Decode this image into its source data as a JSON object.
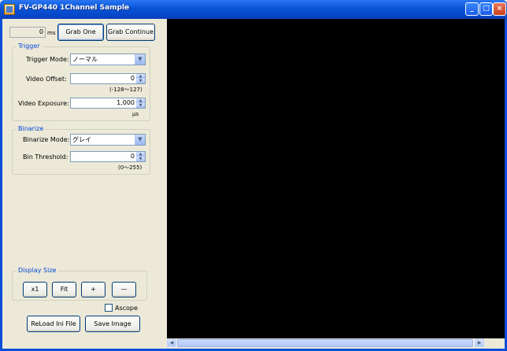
{
  "window": {
    "title": "FV-GP440 1Channel Sample",
    "minimize": "_",
    "maximize": "□",
    "close": "×"
  },
  "toolbar": {
    "ms_value": "0",
    "ms_unit": "ms",
    "grab_one": "Grab One",
    "grab_continue": "Grab Continue"
  },
  "trigger": {
    "legend": "Trigger",
    "mode_label": "Trigger Mode:",
    "mode_value": "ノーマル",
    "offset_label": "Video Offset:",
    "offset_value": "0",
    "offset_range": "(-128～127)",
    "exposure_label": "Video Exposure:",
    "exposure_value": "1,000",
    "exposure_unit": "μs"
  },
  "binarize": {
    "legend": "Binarize",
    "mode_label": "Binarize Mode:",
    "mode_value": "グレイ",
    "threshold_label": "Bin Threshold:",
    "threshold_value": "0",
    "threshold_range": "(0～255)"
  },
  "display_size": {
    "legend": "Display Size",
    "x1": "x1",
    "fit": "Fit",
    "plus": "+",
    "minus": "—"
  },
  "ascope": {
    "label": "Ascope",
    "checked": false
  },
  "bottom": {
    "reload": "ReLoad Ini File",
    "save": "Save Image"
  },
  "scrollbar": {
    "left": "◀",
    "right": "▶"
  },
  "icons": {
    "combo_arrow": "▼",
    "spin_up": "▲",
    "spin_down": "▼"
  }
}
